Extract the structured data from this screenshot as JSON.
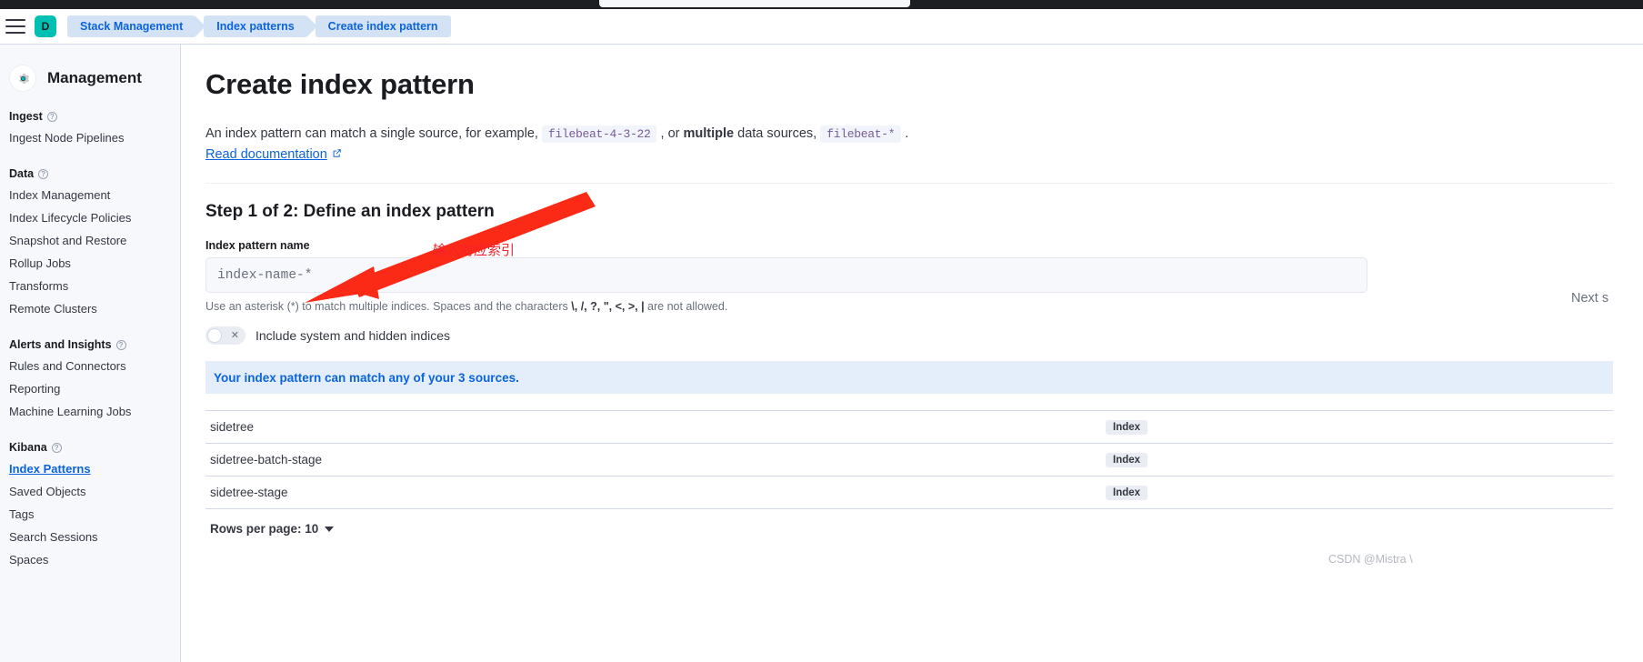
{
  "header": {
    "menu_icon": "hamburger-menu-icon",
    "avatar_initial": "D",
    "breadcrumbs": [
      {
        "label": "Stack Management"
      },
      {
        "label": "Index patterns"
      },
      {
        "label": "Create index pattern"
      }
    ]
  },
  "sidebar": {
    "title": "Management",
    "icon": "gear-icon",
    "groups": [
      {
        "title": "Ingest",
        "items": [
          {
            "label": "Ingest Node Pipelines",
            "active": false
          }
        ]
      },
      {
        "title": "Data",
        "items": [
          {
            "label": "Index Management",
            "active": false
          },
          {
            "label": "Index Lifecycle Policies",
            "active": false
          },
          {
            "label": "Snapshot and Restore",
            "active": false
          },
          {
            "label": "Rollup Jobs",
            "active": false
          },
          {
            "label": "Transforms",
            "active": false
          },
          {
            "label": "Remote Clusters",
            "active": false
          }
        ]
      },
      {
        "title": "Alerts and Insights",
        "items": [
          {
            "label": "Rules and Connectors",
            "active": false
          },
          {
            "label": "Reporting",
            "active": false
          },
          {
            "label": "Machine Learning Jobs",
            "active": false
          }
        ]
      },
      {
        "title": "Kibana",
        "items": [
          {
            "label": "Index Patterns",
            "active": true
          },
          {
            "label": "Saved Objects",
            "active": false
          },
          {
            "label": "Tags",
            "active": false
          },
          {
            "label": "Search Sessions",
            "active": false
          },
          {
            "label": "Spaces",
            "active": false
          }
        ]
      }
    ]
  },
  "main": {
    "page_title": "Create index pattern",
    "description": {
      "part1": "An index pattern can match a single source, for example,",
      "code1": "filebeat-4-3-22",
      "part2": ", or",
      "bold1": "multiple",
      "part3": "data sources,",
      "code2": "filebeat-*",
      "part4": "."
    },
    "doc_link": "Read documentation",
    "doc_link_icon": "external-link-icon",
    "step_title": "Step 1 of 2: Define an index pattern",
    "field_label": "Index pattern name",
    "input_placeholder": "index-name-*",
    "input_value": "",
    "help_text": {
      "part1": "Use an asterisk (*) to match multiple indices. Spaces and the characters",
      "chars": "\\, /, ?, \", <, >, |",
      "part2": "are not allowed."
    },
    "toggle": {
      "label": "Include system and hidden indices",
      "state": "off",
      "icon": "cross-icon"
    },
    "callout": "Your index pattern can match any of your 3 sources.",
    "next_button": "Next s",
    "table": {
      "rows": [
        {
          "name": "sidetree",
          "badge": "Index"
        },
        {
          "name": "sidetree-batch-stage",
          "badge": "Index"
        },
        {
          "name": "sidetree-stage",
          "badge": "Index"
        }
      ]
    },
    "pagination": {
      "label": "Rows per page: 10",
      "icon": "chevron-down-icon"
    }
  },
  "annotation": {
    "text": "输入对应索引",
    "color": "#f5222d",
    "arrow_icon": "red-arrow-icon"
  },
  "watermark": "CSDN @Mistra \\"
}
